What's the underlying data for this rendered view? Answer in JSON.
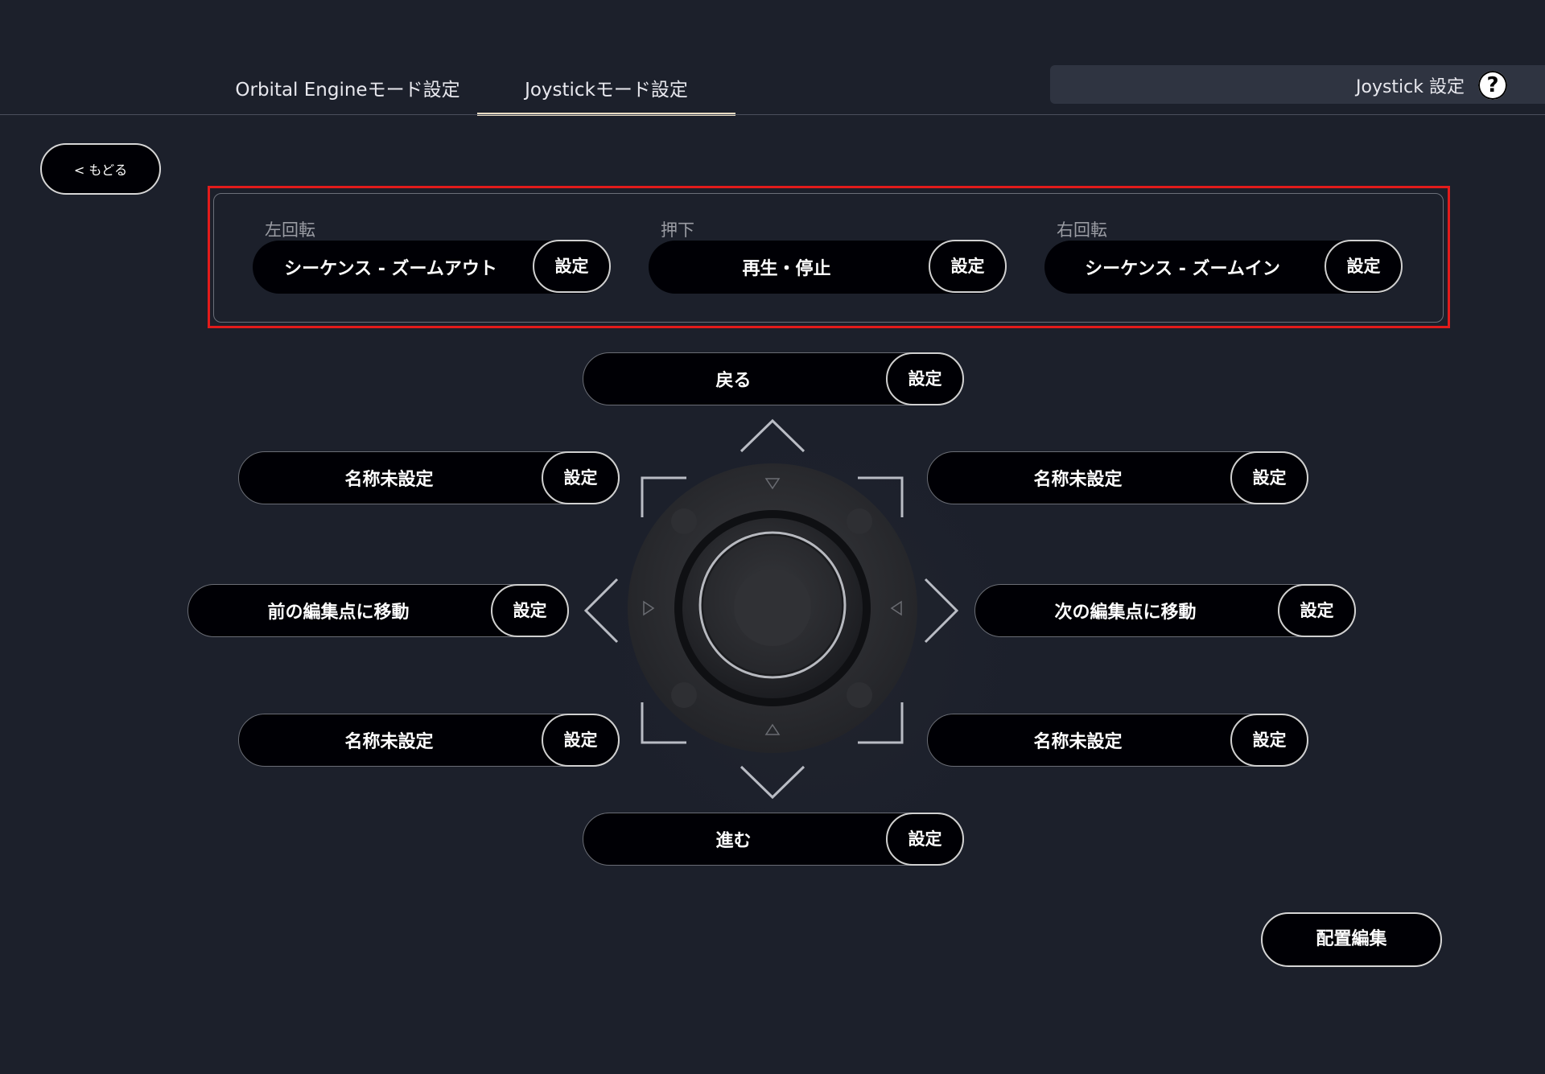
{
  "tabs": [
    {
      "label": "Orbital Engineモード設定",
      "active": false
    },
    {
      "label": "Joystickモード設定",
      "active": true
    }
  ],
  "header": {
    "title": "Joystick 設定",
    "help_icon": "?"
  },
  "back_button": "< もどる",
  "rotation": {
    "left": {
      "label": "左回転",
      "action": "シーケンス - ズームアウト",
      "button": "設定"
    },
    "press": {
      "label": "押下",
      "action": "再生・停止",
      "button": "設定"
    },
    "right": {
      "label": "右回転",
      "action": "シーケンス - ズームイン",
      "button": "設定"
    }
  },
  "directions": {
    "up": {
      "action": "戻る",
      "button": "設定"
    },
    "up_left": {
      "action": "名称未設定",
      "button": "設定"
    },
    "up_right": {
      "action": "名称未設定",
      "button": "設定"
    },
    "left": {
      "action": "前の編集点に移動",
      "button": "設定"
    },
    "right": {
      "action": "次の編集点に移動",
      "button": "設定"
    },
    "down_left": {
      "action": "名称未設定",
      "button": "設定"
    },
    "down_right": {
      "action": "名称未設定",
      "button": "設定"
    },
    "down": {
      "action": "進む",
      "button": "設定"
    }
  },
  "layout_edit_button": "配置編集",
  "colors": {
    "background": "#1c202b",
    "highlight": "#e21b1b",
    "tab_underline": "#e9dcc4"
  }
}
